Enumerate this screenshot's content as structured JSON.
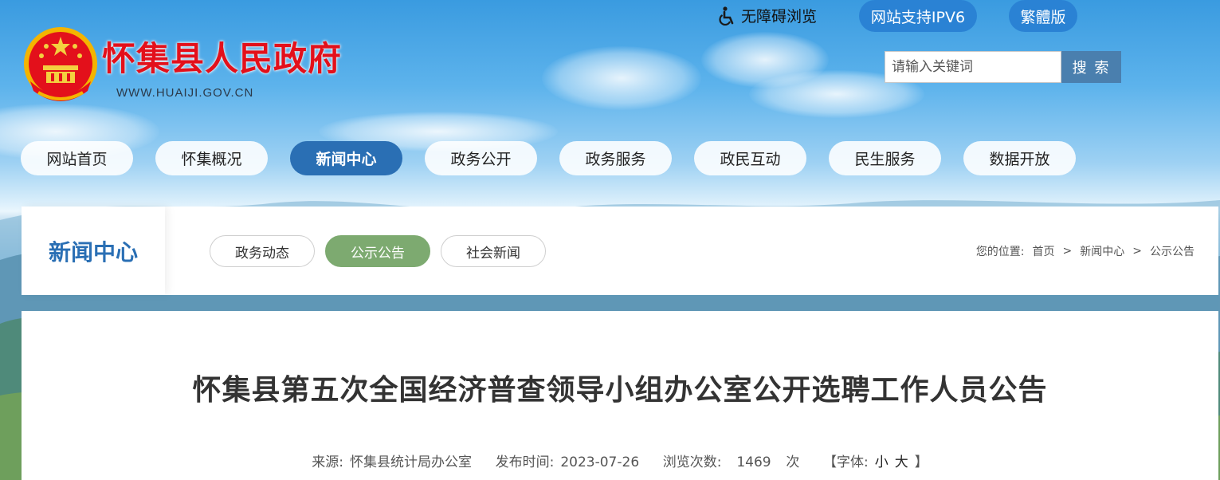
{
  "header": {
    "site_title": "怀集县人民政府",
    "site_url": "WWW.HUAIJI.GOV.CN",
    "accessibility_label": "无障碍浏览",
    "ipv6_label": "网站支持IPV6",
    "traditional_label": "繁體版",
    "search_placeholder": "请输入关键词",
    "search_button": "搜 索"
  },
  "nav": {
    "items": [
      "网站首页",
      "怀集概况",
      "新闻中心",
      "政务公开",
      "政务服务",
      "政民互动",
      "民生服务",
      "数据开放"
    ],
    "active_index": 2
  },
  "section": {
    "title": "新闻中心",
    "tabs": [
      "政务动态",
      "公示公告",
      "社会新闻"
    ],
    "active_tab_index": 1,
    "breadcrumb_prefix": "您的位置:",
    "breadcrumb": [
      "首页",
      "新闻中心",
      "公示公告"
    ],
    "breadcrumb_separator": ">"
  },
  "article": {
    "title": "怀集县第五次全国经济普查领导小组办公室公开选聘工作人员公告",
    "source_label": "来源:",
    "source": "怀集县统计局办公室",
    "date_label": "发布时间:",
    "date": "2023-07-26",
    "views_label": "浏览次数:",
    "views": "1469",
    "views_unit": "次",
    "font_label_open": "【字体:",
    "font_small": "小",
    "font_large": "大",
    "font_label_close": "】"
  },
  "colors": {
    "accent_blue": "#2a6fb4",
    "top_pill_blue": "#2a82d4",
    "title_red": "#e3101b",
    "active_tab_green": "#7daa70",
    "search_button": "#4a7fae"
  },
  "icons": {
    "accessibility": "wheelchair-icon",
    "emblem": "national-emblem"
  }
}
